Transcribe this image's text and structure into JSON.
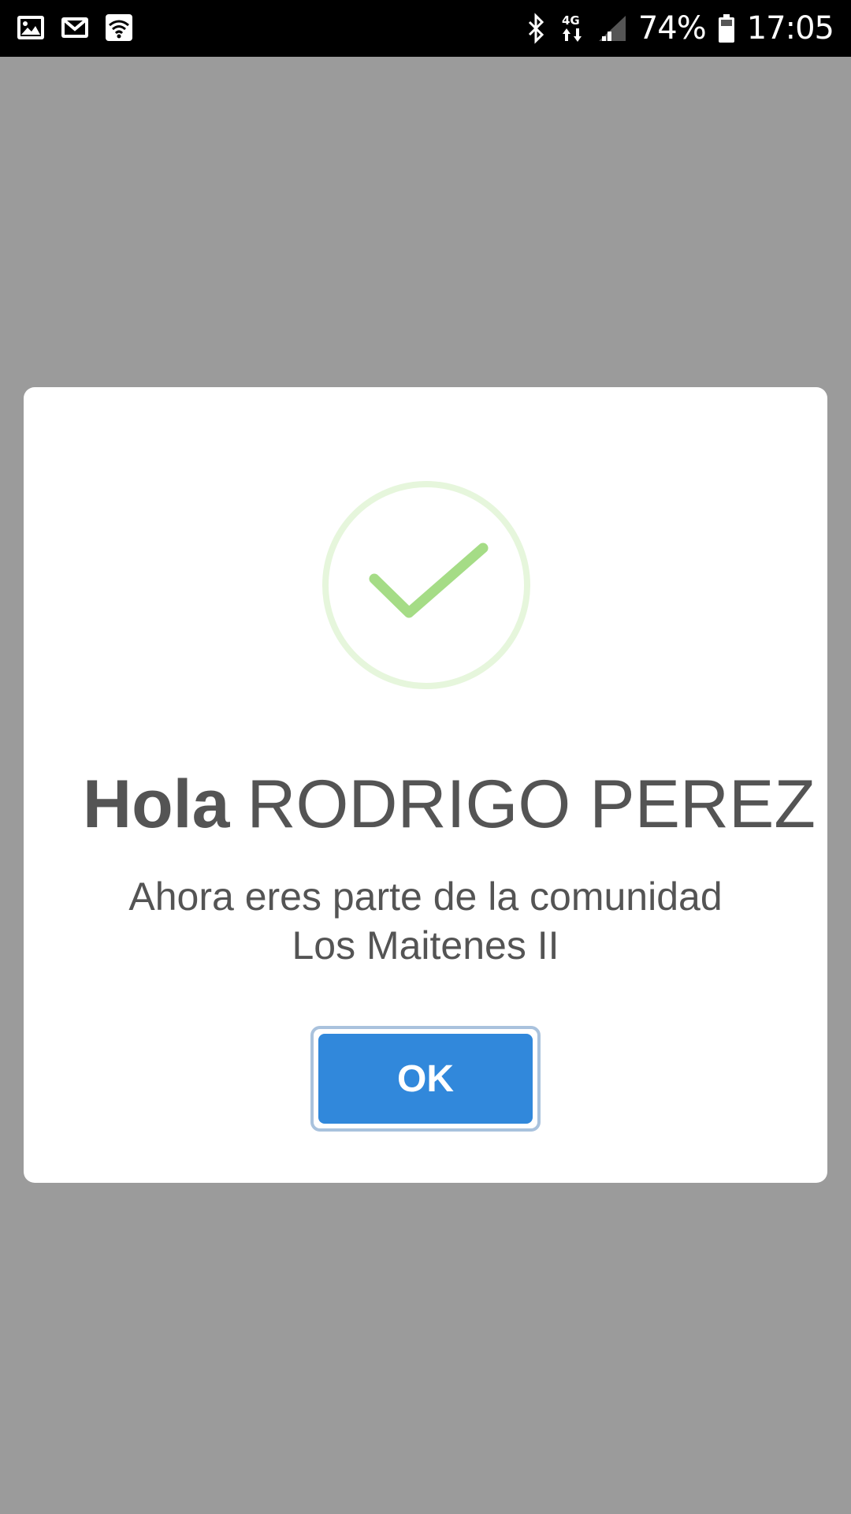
{
  "status_bar": {
    "left_icons": [
      "image-icon",
      "gmail-icon",
      "wifi-calling-icon"
    ],
    "right_icons": [
      "bluetooth-icon",
      "4g-data-icon",
      "signal-icon",
      "battery-icon"
    ],
    "battery_percent": "74%",
    "time": "17:05"
  },
  "dialog": {
    "icon": "success-check-icon",
    "title_greeting": "Hola",
    "title_name": "RODRIGO PEREZ",
    "message_line1": "Ahora eres parte de la comunidad",
    "message_line2": "Los Maitenes II",
    "ok_label": "OK"
  },
  "colors": {
    "overlay": "#9b9b9b",
    "check": "#a5dc86",
    "check_ring": "#e6f6dc",
    "button": "#3188db",
    "text": "#545454"
  }
}
